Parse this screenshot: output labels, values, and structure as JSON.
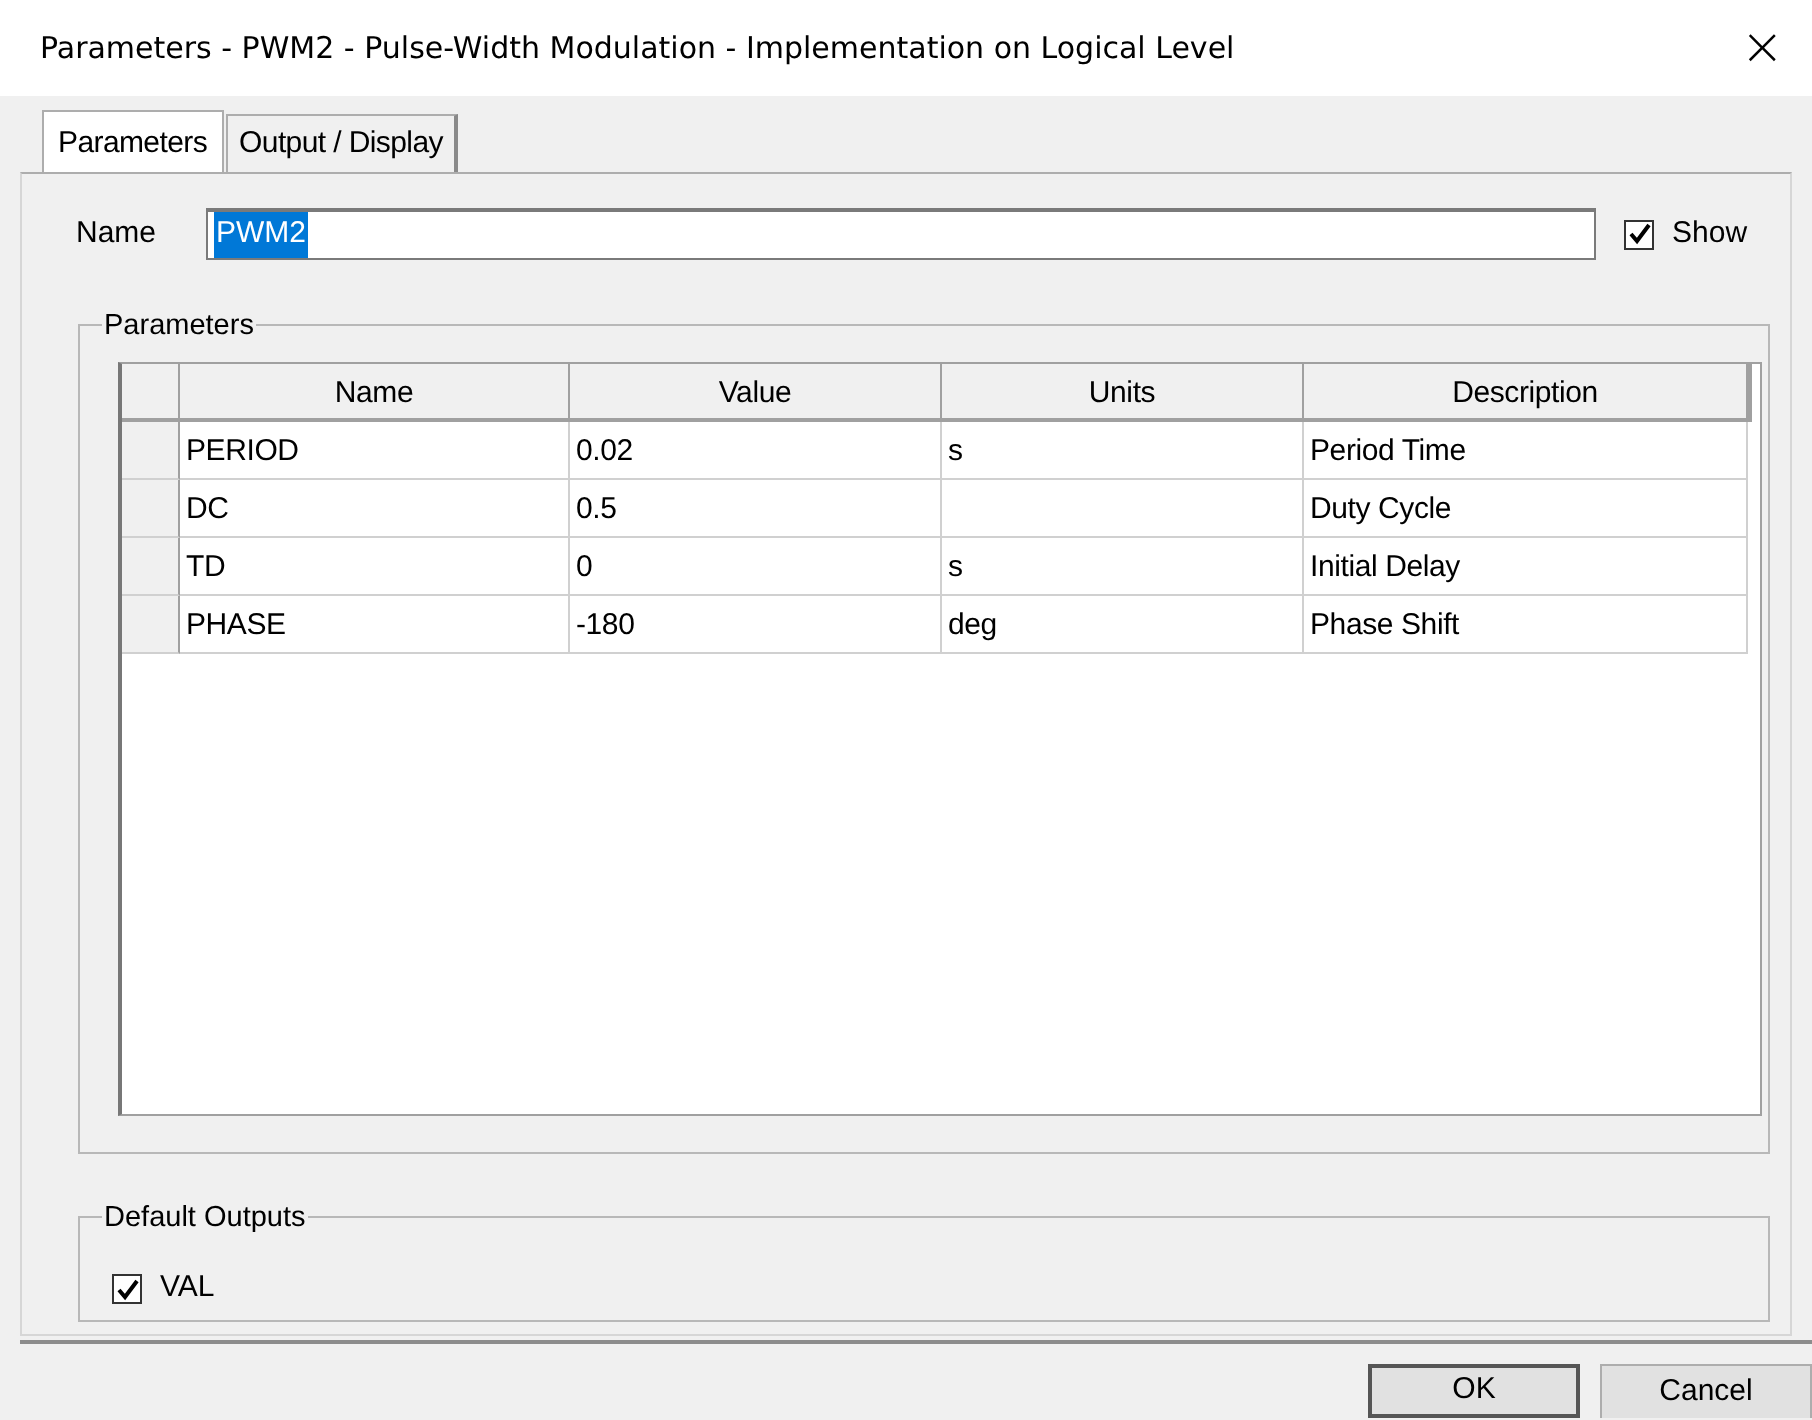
{
  "window": {
    "title": "Parameters - PWM2 - Pulse-Width Modulation - Implementation on Logical Level",
    "close": "×"
  },
  "tabs": [
    {
      "label": "Parameters",
      "selected": true
    },
    {
      "label": "Output / Display",
      "selected": false
    }
  ],
  "name_field": {
    "label": "Name",
    "value": "PWM2",
    "text_selected": true
  },
  "show": {
    "label": "Show",
    "checked": true
  },
  "parameters_group": {
    "title": "Parameters",
    "table": {
      "columns": [
        "Name",
        "Value",
        "Units",
        "Description"
      ],
      "rows": [
        [
          "PERIOD",
          "0.02",
          "s",
          "Period Time"
        ],
        [
          "DC",
          "0.5",
          "",
          "Duty Cycle"
        ],
        [
          "TD",
          "0",
          "s",
          "Initial Delay"
        ],
        [
          "PHASE",
          "-180",
          "deg",
          "Phase Shift"
        ]
      ]
    }
  },
  "default_outputs": {
    "title": "Default Outputs",
    "items": [
      {
        "label": "VAL",
        "checked": true
      }
    ]
  },
  "buttons": [
    "OK",
    "Cancel"
  ]
}
